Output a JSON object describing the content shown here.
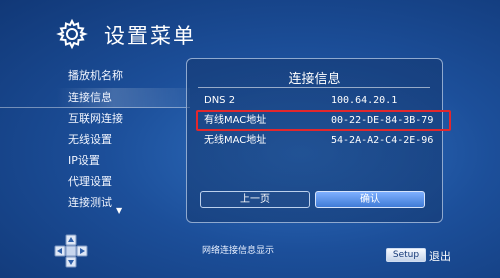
{
  "header": {
    "title": "设置菜单",
    "icon": "gear-icon"
  },
  "menu": {
    "items": [
      {
        "label": "播放机名称"
      },
      {
        "label": "连接信息"
      },
      {
        "label": "互联网连接"
      },
      {
        "label": "无线设置"
      },
      {
        "label": "IP设置"
      },
      {
        "label": "代理设置"
      },
      {
        "label": "连接测试"
      }
    ],
    "active_index": 1,
    "more_indicator": "▼"
  },
  "panel": {
    "title": "连接信息",
    "rows": [
      {
        "key": "DNS 2",
        "value": "100.64.20.1"
      },
      {
        "key": "有线MAC地址",
        "value": "00-22-DE-84-3B-79"
      },
      {
        "key": "无线MAC地址",
        "value": "54-2A-A2-C4-2E-96"
      }
    ],
    "buttons": {
      "prev": "上一页",
      "ok": "确认"
    }
  },
  "footer": {
    "hint": "网络连接信息显示",
    "setup_label": "Setup",
    "exit_label": "退出"
  },
  "colors": {
    "highlight": "#e3272c",
    "background": "#1c4f9a"
  }
}
